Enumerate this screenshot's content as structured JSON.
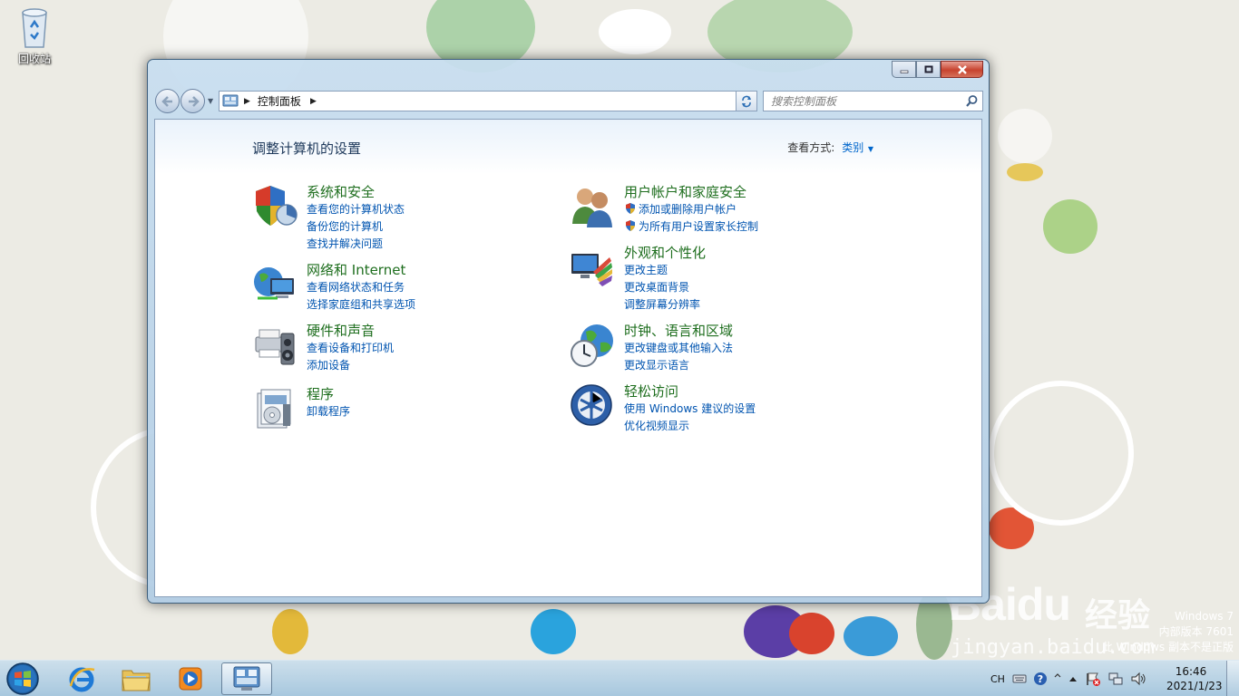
{
  "desktop": {
    "recycle_bin_label": "回收站",
    "windows_version": {
      "line1": "Windows 7",
      "line2": "内部版本 7601",
      "line3": "此 Windows 副本不是正版"
    },
    "watermark": {
      "brand": "Baidu",
      "brand_cn": "经验",
      "url": "jingyan.baidu.com"
    }
  },
  "window": {
    "caption_buttons": [
      "minimize-icon",
      "maximize-icon",
      "close-icon"
    ],
    "address": {
      "crumb": "控制面板"
    },
    "search": {
      "placeholder": "搜索控制面板"
    },
    "page_title": "调整计算机的设置",
    "view_by": {
      "label": "查看方式:",
      "value": "类别"
    },
    "categories": [
      {
        "icon": "system-security-icon",
        "title": "系统和安全",
        "links": [
          "查看您的计算机状态",
          "备份您的计算机",
          "查找并解决问题"
        ]
      },
      {
        "icon": "network-internet-icon",
        "title": "网络和 Internet",
        "links": [
          "查看网络状态和任务",
          "选择家庭组和共享选项"
        ]
      },
      {
        "icon": "hardware-sound-icon",
        "title": "硬件和声音",
        "links": [
          "查看设备和打印机",
          "添加设备"
        ]
      },
      {
        "icon": "programs-icon",
        "title": "程序",
        "links": [
          "卸载程序"
        ]
      },
      {
        "icon": "user-accounts-icon",
        "title": "用户帐户和家庭安全",
        "links": [
          "添加或删除用户帐户",
          "为所有用户设置家长控制"
        ]
      },
      {
        "icon": "appearance-personalization-icon",
        "title": "外观和个性化",
        "links": [
          "更改主题",
          "更改桌面背景",
          "调整屏幕分辨率"
        ]
      },
      {
        "icon": "clock-language-region-icon",
        "title": "时钟、语言和区域",
        "links": [
          "更改键盘或其他输入法",
          "更改显示语言"
        ]
      },
      {
        "icon": "ease-of-access-icon",
        "title": "轻松访问",
        "links": [
          "使用 Windows 建议的设置",
          "优化视频显示"
        ]
      }
    ]
  },
  "taskbar": {
    "items": [
      "start-orb-icon",
      "internet-explorer-icon",
      "windows-explorer-icon",
      "media-player-icon",
      "control-panel-icon"
    ],
    "tray": {
      "language": "CH"
    },
    "clock": {
      "time": "16:46",
      "date": "2021/1/23"
    }
  },
  "colors": {
    "category_title": "#1e6e1e",
    "link": "#0054b0",
    "page_title": "#1e395b"
  }
}
